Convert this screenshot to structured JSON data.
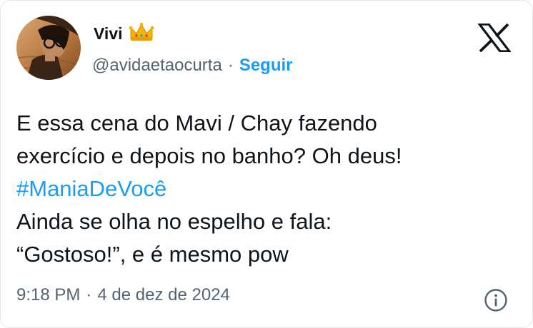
{
  "author": {
    "display_name": "Vivi",
    "badge_icon": "crown-emoji",
    "handle": "@avidaetaocurta",
    "separator": "·",
    "follow_label": "Seguir"
  },
  "post": {
    "lines": [
      "E essa cena do Mavi / Chay fazendo",
      "exercício e depois no banho? Oh deus!"
    ],
    "hashtag": "#ManiaDeVocê",
    "lines_after": [
      "Ainda se olha no espelho e fala:",
      "“Gostoso!”, e é mesmo pow"
    ]
  },
  "meta": {
    "time": "9:18 PM",
    "separator": "·",
    "date": "4 de dez de 2024"
  },
  "icons": {
    "brand": "x-logo-icon",
    "info": "info-icon"
  },
  "colors": {
    "link": "#1d9bf0",
    "secondary_text": "#536471",
    "primary_text": "#0f1419"
  }
}
